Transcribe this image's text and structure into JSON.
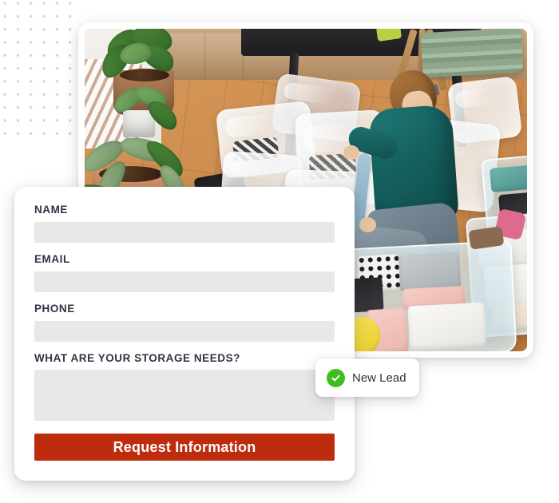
{
  "background": {
    "dot_pattern_color": "#d4d4d4",
    "page_bg": "#ffffff"
  },
  "photo_card": {
    "name": "storage-photo-card",
    "alt": "Woman in teal pullover kneeling on a wooden floor sorting clothes into vacuum-sealed plastic bags and clear storage bins, with potted plants nearby",
    "scene_elements": [
      "wood-floor",
      "potted-plants",
      "black-table",
      "wooden-stool-legs",
      "folded-green-mats",
      "vacuum-sealed-clothing-bags",
      "woman-in-teal-pullover",
      "clear-storage-bins",
      "folded-clothes"
    ]
  },
  "form": {
    "title": "Storage request form",
    "fields": [
      {
        "id": "name",
        "label": "NAME",
        "value": "",
        "placeholder": "",
        "type": "text"
      },
      {
        "id": "email",
        "label": "EMAIL",
        "value": "",
        "placeholder": "",
        "type": "email"
      },
      {
        "id": "phone",
        "label": "PHONE",
        "value": "",
        "placeholder": "",
        "type": "tel"
      }
    ],
    "textarea": {
      "id": "needs",
      "label": "WHAT ARE YOUR STORAGE NEEDS?",
      "value": "",
      "placeholder": ""
    },
    "submit": {
      "label": "Request Information",
      "bg_color": "#bd2c0d",
      "text_color": "#ffffff"
    },
    "label_color": "#2c3542",
    "input_bg_color": "#e8e8e8"
  },
  "toast": {
    "icon": "check-circle-icon",
    "icon_color": "#3fbe1f",
    "label": "New Lead",
    "text_color": "#2f3338"
  }
}
